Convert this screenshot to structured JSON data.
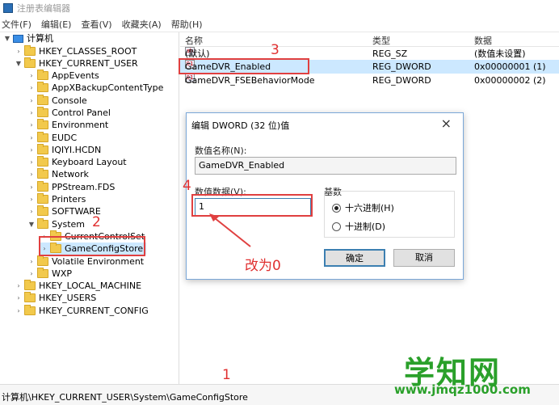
{
  "window": {
    "title": "注册表编辑器"
  },
  "menu": [
    "文件(F)",
    "编辑(E)",
    "查看(V)",
    "收藏夹(A)",
    "帮助(H)"
  ],
  "tree": {
    "root": "计算机",
    "items": [
      "HKEY_CLASSES_ROOT",
      "HKEY_CURRENT_USER",
      "AppEvents",
      "AppXBackupContentType",
      "Console",
      "Control Panel",
      "Environment",
      "EUDC",
      "IQIYI.HCDN",
      "Keyboard Layout",
      "Network",
      "PPStream.FDS",
      "Printers",
      "SOFTWARE",
      "System",
      "CurrentControlSet",
      "GameConfigStore",
      "Volatile Environment",
      "WXP",
      "HKEY_LOCAL_MACHINE",
      "HKEY_USERS",
      "HKEY_CURRENT_CONFIG"
    ]
  },
  "list": {
    "headers": [
      "名称",
      "类型",
      "数据"
    ],
    "rows": [
      {
        "name": "(默认)",
        "type": "REG_SZ",
        "data": "(数值未设置)"
      },
      {
        "name": "GameDVR_Enabled",
        "type": "REG_DWORD",
        "data": "0x00000001 (1)"
      },
      {
        "name": "GameDVR_FSEBehaviorMode",
        "type": "REG_DWORD",
        "data": "0x00000002 (2)"
      }
    ]
  },
  "dialog": {
    "title": "编辑 DWORD (32 位)值",
    "close": "×",
    "name_label": "数值名称(N):",
    "name_value": "GameDVR_Enabled",
    "data_label": "数值数据(V):",
    "data_value": "1",
    "base_label": "基数",
    "hex_label": "十六进制(H)",
    "dec_label": "十进制(D)",
    "ok": "确定",
    "cancel": "取消"
  },
  "annotations": {
    "n1": "1",
    "n2": "2",
    "n3": "3",
    "n4": "4",
    "change_text": "改为0"
  },
  "status": {
    "path": "计算机\\HKEY_CURRENT_USER\\System\\GameConfigStore"
  },
  "watermark": {
    "cn": "学知网",
    "url": "www.jmqz1000.com"
  }
}
